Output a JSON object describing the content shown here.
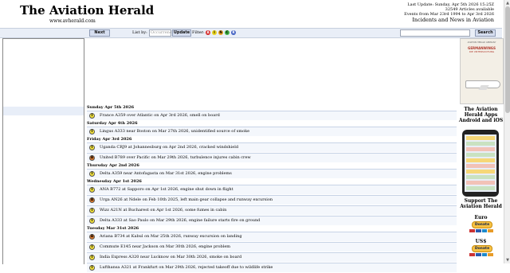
{
  "header": {
    "title": "The Aviation Herald",
    "url": "www.avherald.com",
    "last_update": "Last Update: Sunday, Apr 5th 2026 15:25Z",
    "articles": "32549 Articles available",
    "events_range": "Events from Mar 23rd 1994 to Apr 3rd 2026",
    "tagline": "Incidents and News in Aviation"
  },
  "toolbar": {
    "next_label": "Next",
    "list_by_label": "List by:",
    "list_by_placeholder": "Occurrence",
    "update_label": "Update",
    "filter_label": "Filter:",
    "filters": [
      {
        "letter": "A",
        "color": "#d42a2a"
      },
      {
        "letter": "I",
        "color": "#e8d21a"
      },
      {
        "letter": "N",
        "color": "#e8a020"
      },
      {
        "letter": "C",
        "color": "#3cb043"
      },
      {
        "letter": "R",
        "color": "#4361c2"
      }
    ],
    "search_value": "",
    "search_label": "Search"
  },
  "events": [
    {
      "date": "Sunday Apr 5th 2026",
      "items": [
        {
          "sev": "I",
          "text": "France A359 over Atlantic on Apr 3rd 2026, smell on board"
        }
      ]
    },
    {
      "date": "Saturday Apr 4th 2026",
      "items": [
        {
          "sev": "I",
          "text": "Lingus A333 near Boston on Mar 27th 2026, unidentified source of smoke"
        }
      ]
    },
    {
      "date": "Friday Apr 3rd 2026",
      "items": [
        {
          "sev": "I",
          "text": "Uganda CRJ9 at Johannesburg on Apr 2nd 2026, cracked windshield"
        },
        {
          "sev": "A",
          "text": "United B789 over Pacific on Mar 29th 2026, turbulence injures cabin crew"
        }
      ]
    },
    {
      "date": "Thursday Apr 2nd 2026",
      "items": [
        {
          "sev": "I",
          "text": "Delta A359 near Antofagasta on Mar 31st 2026, engine problems"
        }
      ]
    },
    {
      "date": "Wednesday Apr 1st 2026",
      "items": [
        {
          "sev": "I",
          "text": "ANA B772 at Sapporo on Apr 1st 2026, engine shut down in flight"
        },
        {
          "sev": "A",
          "text": "Urga AN26 at Ndele on Feb 10th 2025, left main gear collapse and runway excursion"
        },
        {
          "sev": "I",
          "text": "Wizz A21N at Bucharest on Apr 1st 2026, some fumes in cabin"
        },
        {
          "sev": "I",
          "text": "Delta A333 at Sao Paulo on Mar 29th 2026, engine failure starts fire on ground"
        }
      ]
    },
    {
      "date": "Tuesday Mar 31st 2026",
      "items": [
        {
          "sev": "A",
          "text": "Ariana B734 at Kabul on Mar 25th 2026, runway excursion on landing"
        },
        {
          "sev": "I",
          "text": "Commute E145 near Jackson on Mar 30th 2026, engine problem"
        },
        {
          "sev": "I",
          "text": "India Express A320 near Lucknow on Mar 30th 2026, smoke on board"
        },
        {
          "sev": "I",
          "text": "Lufthansa A321 at Frankfurt on Mar 29th 2026, rejected takeoff due to wildlife strike"
        }
      ]
    }
  ],
  "sidebar": {
    "ad_small": "AVIATION HERALD GERMANY",
    "ad_brand": "GERMANWINGS",
    "ad_sub": "DIE UNTERSUCHUNG",
    "apps_title": "The Aviation Herald Apps Android and iOS",
    "support_title": "Support The Aviation Herald",
    "euro_label": "Euro",
    "usd_label": "US$",
    "donate_label": "Donate"
  },
  "colors": {
    "incident": "#f2e13b",
    "accident": "#e07a2b",
    "toolbar_bg": "#e9eef7",
    "row_bg": "#f4f7fc"
  }
}
